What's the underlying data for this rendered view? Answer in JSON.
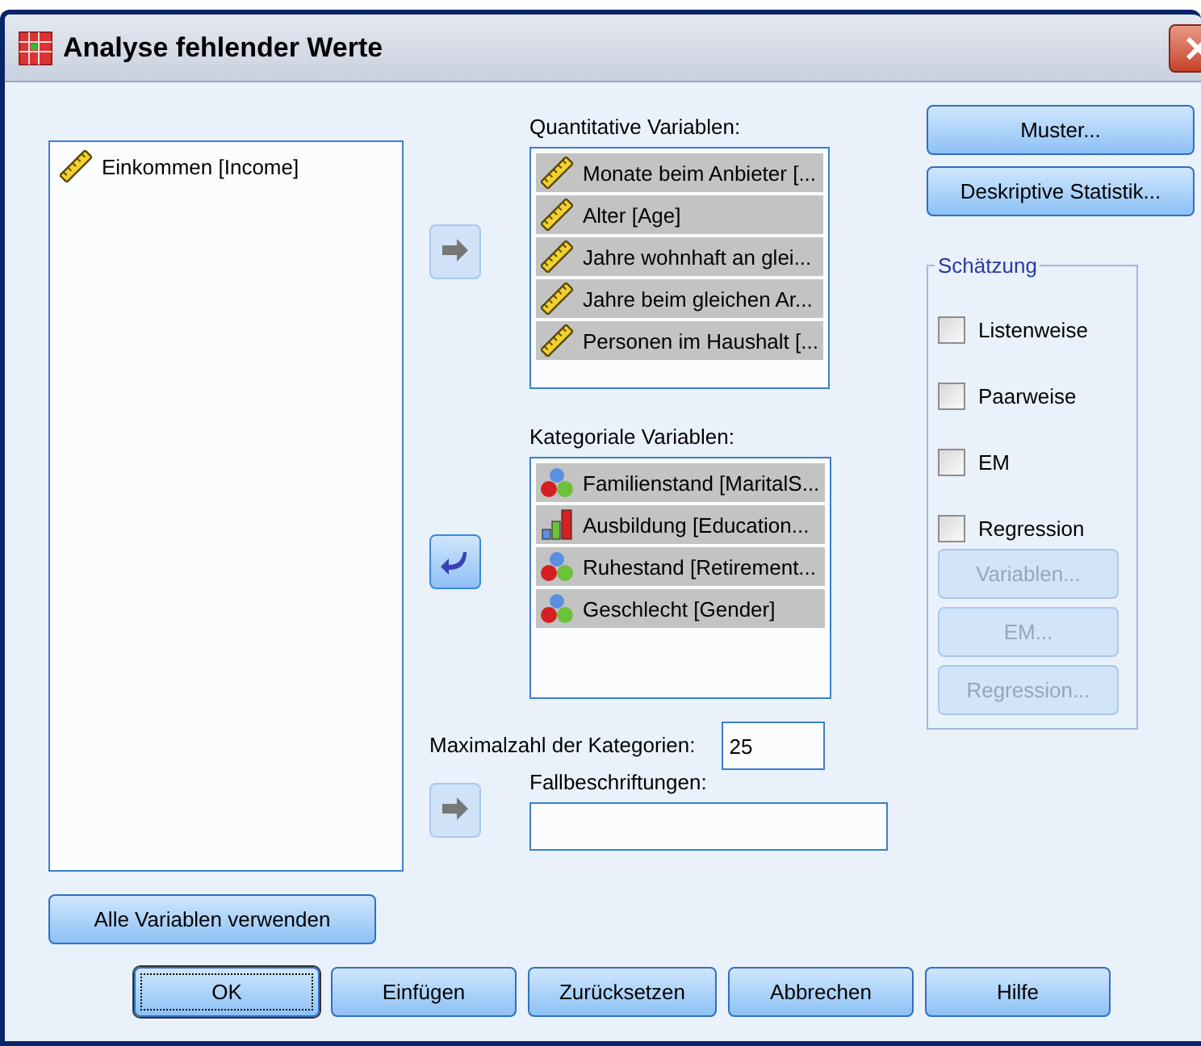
{
  "window": {
    "title": "Analyse fehlender Werte"
  },
  "source_list": {
    "items": [
      {
        "label": "Einkommen [Income]",
        "kind": "scale",
        "selected": false
      }
    ]
  },
  "quantitative": {
    "label": "Quantitative Variablen:",
    "arrow": {
      "kind": "right",
      "disabled": true
    },
    "items": [
      {
        "label": "Monate beim Anbieter [...",
        "kind": "scale",
        "selected": true
      },
      {
        "label": "Alter [Age]",
        "kind": "scale",
        "selected": true
      },
      {
        "label": "Jahre wohnhaft an glei...",
        "kind": "scale",
        "selected": true
      },
      {
        "label": "Jahre beim gleichen Ar...",
        "kind": "scale",
        "selected": true
      },
      {
        "label": "Personen im Haushalt [...",
        "kind": "scale",
        "selected": true
      }
    ]
  },
  "categorical": {
    "label": "Kategoriale Variablen:",
    "arrow": {
      "kind": "left",
      "disabled": false
    },
    "items": [
      {
        "label": "Familienstand [MaritalS...",
        "kind": "nominal",
        "selected": true
      },
      {
        "label": "Ausbildung [Education...",
        "kind": "ordinal",
        "selected": true
      },
      {
        "label": "Ruhestand [Retirement...",
        "kind": "nominal",
        "selected": true
      },
      {
        "label": "Geschlecht [Gender]",
        "kind": "nominal",
        "selected": true
      }
    ]
  },
  "max_categories": {
    "label": "Maximalzahl der Kategorien:",
    "value": "25"
  },
  "case_labels": {
    "label": "Fallbeschriftungen:",
    "arrow": {
      "kind": "right",
      "disabled": true
    }
  },
  "side_buttons": [
    "Muster...",
    "Deskriptive Statistik..."
  ],
  "estimation": {
    "title": "Schätzung",
    "options": [
      {
        "label": "Listenweise",
        "checked": false
      },
      {
        "label": "Paarweise",
        "checked": false
      },
      {
        "label": "EM",
        "checked": false
      },
      {
        "label": "Regression",
        "checked": false
      }
    ],
    "buttons": [
      {
        "label": "Variablen...",
        "disabled": true
      },
      {
        "label": "EM...",
        "disabled": true
      },
      {
        "label": "Regression...",
        "disabled": true
      }
    ]
  },
  "use_all_button": "Alle Variablen verwenden",
  "footer_buttons": [
    {
      "label": "OK",
      "default": true
    },
    {
      "label": "Einfügen",
      "default": false
    },
    {
      "label": "Zurücksetzen",
      "default": false
    },
    {
      "label": "Abbrechen",
      "default": false
    },
    {
      "label": "Hilfe",
      "default": false
    }
  ]
}
